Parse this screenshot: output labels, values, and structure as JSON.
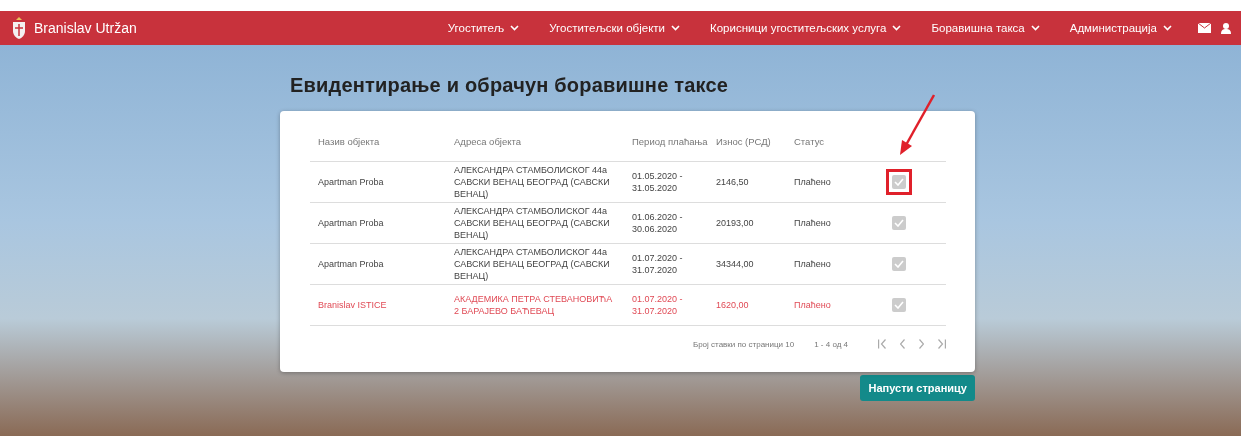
{
  "navbar": {
    "user": "Branislav Utržan",
    "menu": [
      {
        "label": "Угоститељ"
      },
      {
        "label": "Угоститељски објекти"
      },
      {
        "label": "Корисници угоститељских услуга"
      },
      {
        "label": "Боравишна такса"
      },
      {
        "label": "Администрација"
      }
    ]
  },
  "page": {
    "title": "Евидентирање и обрачун боравишне таксе"
  },
  "table": {
    "columns": [
      "Назив објекта",
      "Адреса објекта",
      "Период плаћања",
      "Износ (РСД)",
      "Статус"
    ],
    "rows": [
      {
        "name": "Apartman Proba",
        "address": "АЛЕКСАНДРА СТАМБОЛИСКОГ 44а САВСКИ ВЕНАЦ БЕОГРАД (САВСКИ ВЕНАЦ)",
        "period": "01.05.2020 - 31.05.2020",
        "amount": "2146,50",
        "status": "Плаћено",
        "alert": false,
        "checked": true,
        "disabled": true,
        "highlighted": true
      },
      {
        "name": "Apartman Proba",
        "address": "АЛЕКСАНДРА СТАМБОЛИСКОГ 44а САВСКИ ВЕНАЦ БЕОГРАД (САВСКИ ВЕНАЦ)",
        "period": "01.06.2020 - 30.06.2020",
        "amount": "20193,00",
        "status": "Плаћено",
        "alert": false,
        "checked": true,
        "disabled": true,
        "highlighted": false
      },
      {
        "name": "Apartman Proba",
        "address": "АЛЕКСАНДРА СТАМБОЛИСКОГ 44а САВСКИ ВЕНАЦ БЕОГРАД (САВСКИ ВЕНАЦ)",
        "period": "01.07.2020 - 31.07.2020",
        "amount": "34344,00",
        "status": "Плаћено",
        "alert": false,
        "checked": true,
        "disabled": true,
        "highlighted": false
      },
      {
        "name": "Branislav ISTICE",
        "address": "АКАДЕМИКА ПЕТРА СТЕВАНОВИЋА 2 БАРАЈЕВО БАЋЕВАЦ",
        "period": "01.07.2020 - 31.07.2020",
        "amount": "1620,00",
        "status": "Плаћено",
        "alert": true,
        "checked": true,
        "disabled": true,
        "highlighted": false
      }
    ]
  },
  "paginator": {
    "page_size_label": "Број ставки по страници 10",
    "range": "1 - 4 од 4"
  },
  "leave_button": "Напусти страницу"
}
